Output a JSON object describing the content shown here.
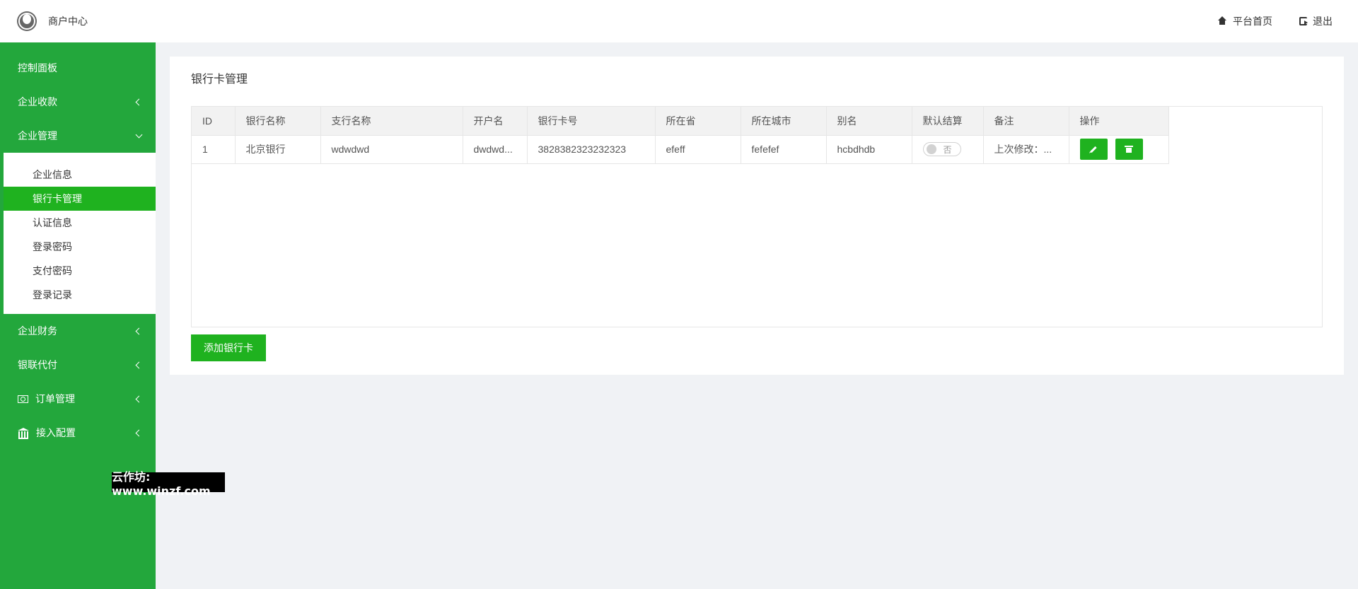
{
  "header": {
    "brand": "商户中心",
    "links": [
      {
        "label": "平台首页",
        "icon": "home-icon"
      },
      {
        "label": "退出",
        "icon": "logout-icon"
      }
    ]
  },
  "sidebar": {
    "items": [
      {
        "label": "控制面板"
      },
      {
        "label": "企业收款"
      },
      {
        "label": "企业管理"
      },
      {
        "label": "企业财务"
      },
      {
        "label": "银联代付"
      },
      {
        "label": "订单管理",
        "icon": "money-icon"
      },
      {
        "label": "接入配置",
        "icon": "bank-icon"
      }
    ],
    "submenu": [
      "企业信息",
      "银行卡管理",
      "认证信息",
      "登录密码",
      "支付密码",
      "登录记录"
    ],
    "active_sub": "银行卡管理",
    "accent": "#23a73c",
    "active_color": "#1fb21f"
  },
  "watermark": "云作坊: www.winzf.com",
  "main": {
    "title": "银行卡管理",
    "table": {
      "headers": [
        "ID",
        "银行名称",
        "支行名称",
        "开户名",
        "银行卡号",
        "所在省",
        "所在城市",
        "别名",
        "默认结算",
        "备注",
        "操作"
      ],
      "rows": [
        {
          "id": "1",
          "bank": "北京银行",
          "branch": "wdwdwd",
          "holder": "dwdwd...",
          "card": "3828382323232323",
          "province": "efeff",
          "city": "fefefef",
          "alias": "hcbdhdb",
          "default_label": "否",
          "remark": "上次修改：..."
        }
      ]
    },
    "add_button": "添加银行卡"
  }
}
